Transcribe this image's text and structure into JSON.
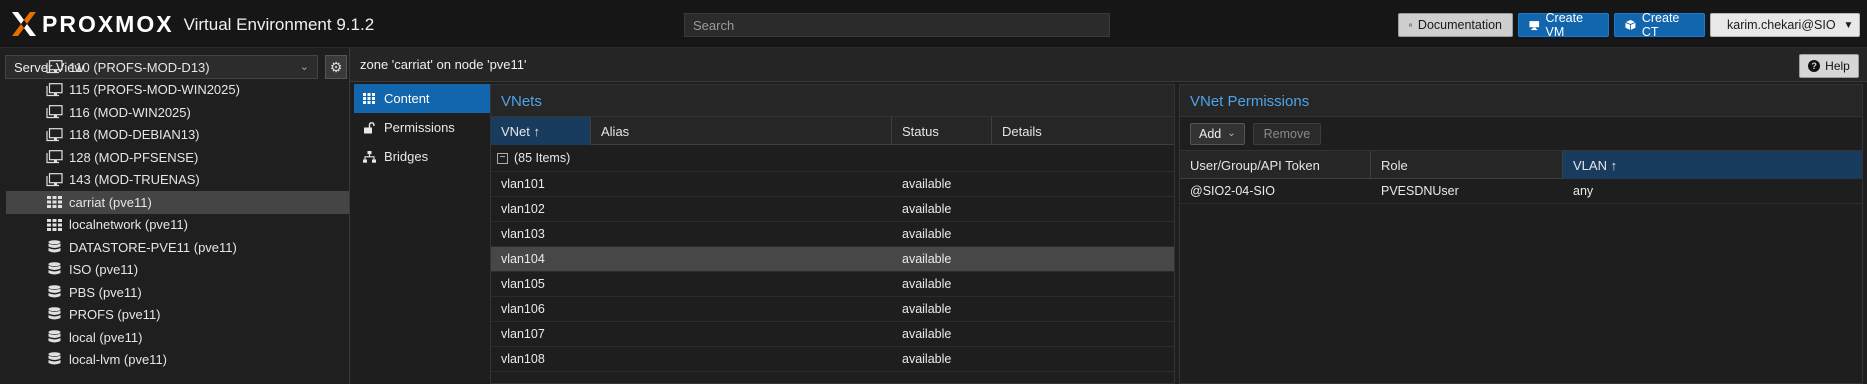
{
  "header": {
    "logo_text": "PROXMOX",
    "logo_subtitle": "Virtual Environment 9.1.2",
    "search_placeholder": "Search",
    "documentation_label": "Documentation",
    "create_vm_label": "Create VM",
    "create_ct_label": "Create CT",
    "user_label": "karim.chekari@SIO"
  },
  "sidebar": {
    "view_selector": "Server View",
    "tree": [
      {
        "label": "110 (PROFS-MOD-D13)",
        "icon": "vm-template-icon"
      },
      {
        "label": "115 (PROFS-MOD-WIN2025)",
        "icon": "vm-template-icon"
      },
      {
        "label": "116 (MOD-WIN2025)",
        "icon": "vm-template-icon"
      },
      {
        "label": "118 (MOD-DEBIAN13)",
        "icon": "vm-template-icon"
      },
      {
        "label": "128 (MOD-PFSENSE)",
        "icon": "vm-template-icon"
      },
      {
        "label": "143 (MOD-TRUENAS)",
        "icon": "vm-template-icon"
      },
      {
        "label": "carriat (pve11)",
        "icon": "sdn-zone-icon",
        "selected": true
      },
      {
        "label": "localnetwork (pve11)",
        "icon": "sdn-zone-icon"
      },
      {
        "label": "DATASTORE-PVE11 (pve11)",
        "icon": "storage-icon"
      },
      {
        "label": "ISO (pve11)",
        "icon": "storage-icon"
      },
      {
        "label": "PBS (pve11)",
        "icon": "storage-icon"
      },
      {
        "label": "PROFS (pve11)",
        "icon": "storage-icon"
      },
      {
        "label": "local (pve11)",
        "icon": "storage-icon"
      },
      {
        "label": "local-lvm (pve11)",
        "icon": "storage-icon"
      }
    ]
  },
  "main": {
    "title": "zone 'carriat' on node 'pve11'",
    "help_label": "Help",
    "nav": [
      {
        "label": "Content",
        "active": true
      },
      {
        "label": "Permissions",
        "active": false
      },
      {
        "label": "Bridges",
        "active": false
      }
    ]
  },
  "vnets": {
    "title": "VNets",
    "columns": [
      "VNet ↑",
      "Alias",
      "Status",
      "Details"
    ],
    "group_label": "(85 Items)",
    "rows": [
      {
        "vnet": "vlan101",
        "alias": "",
        "status": "available",
        "details": ""
      },
      {
        "vnet": "vlan102",
        "alias": "",
        "status": "available",
        "details": ""
      },
      {
        "vnet": "vlan103",
        "alias": "",
        "status": "available",
        "details": ""
      },
      {
        "vnet": "vlan104",
        "alias": "",
        "status": "available",
        "details": "",
        "selected": true
      },
      {
        "vnet": "vlan105",
        "alias": "",
        "status": "available",
        "details": ""
      },
      {
        "vnet": "vlan106",
        "alias": "",
        "status": "available",
        "details": ""
      },
      {
        "vnet": "vlan107",
        "alias": "",
        "status": "available",
        "details": ""
      },
      {
        "vnet": "vlan108",
        "alias": "",
        "status": "available",
        "details": ""
      }
    ]
  },
  "permissions": {
    "title": "VNet Permissions",
    "add_label": "Add",
    "remove_label": "Remove",
    "columns": [
      "User/Group/API Token",
      "Role",
      "VLAN ↑"
    ],
    "rows": [
      {
        "user": "@SIO2-04-SIO",
        "role": "PVESDNUser",
        "vlan": "any"
      }
    ]
  },
  "colors": {
    "accent": "#1266ad",
    "panel_title": "#4fa3e8",
    "logo_x_orange": "#e57000"
  }
}
